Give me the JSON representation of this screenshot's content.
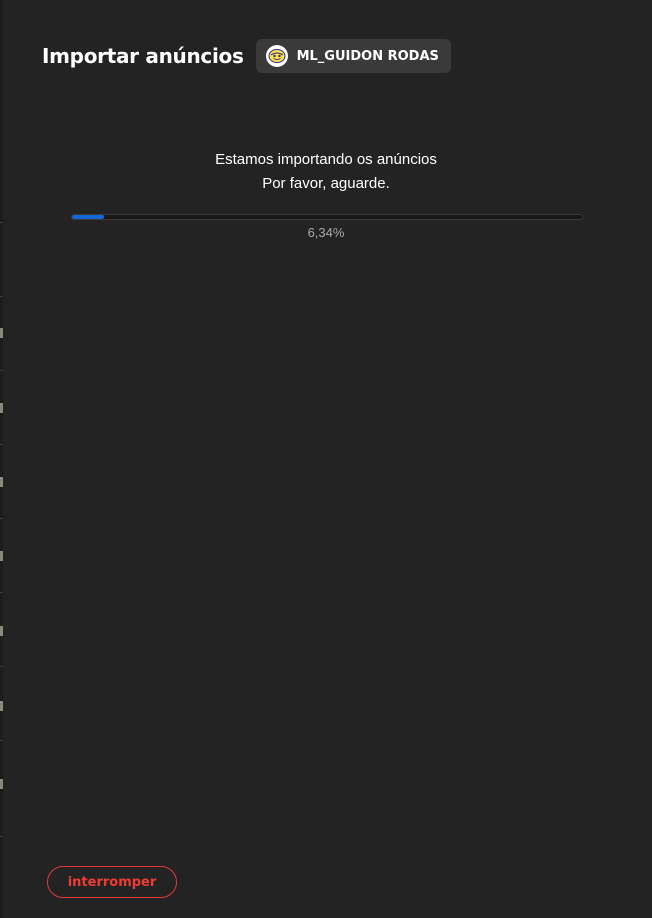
{
  "header": {
    "title": "Importar anúncios",
    "account_name": "ML_GUIDON RODAS",
    "account_icon": "smiley-icon"
  },
  "status": {
    "line1": "Estamos importando os anúncios",
    "line2": "Por favor, aguarde."
  },
  "progress": {
    "percent_label": "6,34%",
    "value_percent": 6.34,
    "fill_color": "#1565d8"
  },
  "actions": {
    "stop_label": "interromper",
    "stop_color": "#ef3b36"
  }
}
